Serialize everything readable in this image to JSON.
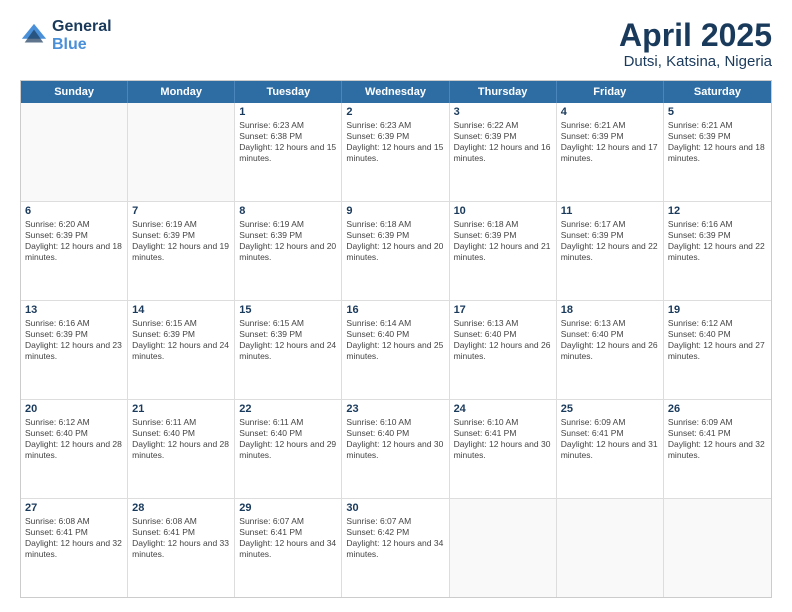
{
  "logo": {
    "line1": "General",
    "line2": "Blue"
  },
  "title": "April 2025",
  "subtitle": "Dutsi, Katsina, Nigeria",
  "days": [
    "Sunday",
    "Monday",
    "Tuesday",
    "Wednesday",
    "Thursday",
    "Friday",
    "Saturday"
  ],
  "weeks": [
    [
      {
        "day": "",
        "sunrise": "",
        "sunset": "",
        "daylight": ""
      },
      {
        "day": "",
        "sunrise": "",
        "sunset": "",
        "daylight": ""
      },
      {
        "day": "1",
        "sunrise": "Sunrise: 6:23 AM",
        "sunset": "Sunset: 6:38 PM",
        "daylight": "Daylight: 12 hours and 15 minutes."
      },
      {
        "day": "2",
        "sunrise": "Sunrise: 6:23 AM",
        "sunset": "Sunset: 6:39 PM",
        "daylight": "Daylight: 12 hours and 15 minutes."
      },
      {
        "day": "3",
        "sunrise": "Sunrise: 6:22 AM",
        "sunset": "Sunset: 6:39 PM",
        "daylight": "Daylight: 12 hours and 16 minutes."
      },
      {
        "day": "4",
        "sunrise": "Sunrise: 6:21 AM",
        "sunset": "Sunset: 6:39 PM",
        "daylight": "Daylight: 12 hours and 17 minutes."
      },
      {
        "day": "5",
        "sunrise": "Sunrise: 6:21 AM",
        "sunset": "Sunset: 6:39 PM",
        "daylight": "Daylight: 12 hours and 18 minutes."
      }
    ],
    [
      {
        "day": "6",
        "sunrise": "Sunrise: 6:20 AM",
        "sunset": "Sunset: 6:39 PM",
        "daylight": "Daylight: 12 hours and 18 minutes."
      },
      {
        "day": "7",
        "sunrise": "Sunrise: 6:19 AM",
        "sunset": "Sunset: 6:39 PM",
        "daylight": "Daylight: 12 hours and 19 minutes."
      },
      {
        "day": "8",
        "sunrise": "Sunrise: 6:19 AM",
        "sunset": "Sunset: 6:39 PM",
        "daylight": "Daylight: 12 hours and 20 minutes."
      },
      {
        "day": "9",
        "sunrise": "Sunrise: 6:18 AM",
        "sunset": "Sunset: 6:39 PM",
        "daylight": "Daylight: 12 hours and 20 minutes."
      },
      {
        "day": "10",
        "sunrise": "Sunrise: 6:18 AM",
        "sunset": "Sunset: 6:39 PM",
        "daylight": "Daylight: 12 hours and 21 minutes."
      },
      {
        "day": "11",
        "sunrise": "Sunrise: 6:17 AM",
        "sunset": "Sunset: 6:39 PM",
        "daylight": "Daylight: 12 hours and 22 minutes."
      },
      {
        "day": "12",
        "sunrise": "Sunrise: 6:16 AM",
        "sunset": "Sunset: 6:39 PM",
        "daylight": "Daylight: 12 hours and 22 minutes."
      }
    ],
    [
      {
        "day": "13",
        "sunrise": "Sunrise: 6:16 AM",
        "sunset": "Sunset: 6:39 PM",
        "daylight": "Daylight: 12 hours and 23 minutes."
      },
      {
        "day": "14",
        "sunrise": "Sunrise: 6:15 AM",
        "sunset": "Sunset: 6:39 PM",
        "daylight": "Daylight: 12 hours and 24 minutes."
      },
      {
        "day": "15",
        "sunrise": "Sunrise: 6:15 AM",
        "sunset": "Sunset: 6:39 PM",
        "daylight": "Daylight: 12 hours and 24 minutes."
      },
      {
        "day": "16",
        "sunrise": "Sunrise: 6:14 AM",
        "sunset": "Sunset: 6:40 PM",
        "daylight": "Daylight: 12 hours and 25 minutes."
      },
      {
        "day": "17",
        "sunrise": "Sunrise: 6:13 AM",
        "sunset": "Sunset: 6:40 PM",
        "daylight": "Daylight: 12 hours and 26 minutes."
      },
      {
        "day": "18",
        "sunrise": "Sunrise: 6:13 AM",
        "sunset": "Sunset: 6:40 PM",
        "daylight": "Daylight: 12 hours and 26 minutes."
      },
      {
        "day": "19",
        "sunrise": "Sunrise: 6:12 AM",
        "sunset": "Sunset: 6:40 PM",
        "daylight": "Daylight: 12 hours and 27 minutes."
      }
    ],
    [
      {
        "day": "20",
        "sunrise": "Sunrise: 6:12 AM",
        "sunset": "Sunset: 6:40 PM",
        "daylight": "Daylight: 12 hours and 28 minutes."
      },
      {
        "day": "21",
        "sunrise": "Sunrise: 6:11 AM",
        "sunset": "Sunset: 6:40 PM",
        "daylight": "Daylight: 12 hours and 28 minutes."
      },
      {
        "day": "22",
        "sunrise": "Sunrise: 6:11 AM",
        "sunset": "Sunset: 6:40 PM",
        "daylight": "Daylight: 12 hours and 29 minutes."
      },
      {
        "day": "23",
        "sunrise": "Sunrise: 6:10 AM",
        "sunset": "Sunset: 6:40 PM",
        "daylight": "Daylight: 12 hours and 30 minutes."
      },
      {
        "day": "24",
        "sunrise": "Sunrise: 6:10 AM",
        "sunset": "Sunset: 6:41 PM",
        "daylight": "Daylight: 12 hours and 30 minutes."
      },
      {
        "day": "25",
        "sunrise": "Sunrise: 6:09 AM",
        "sunset": "Sunset: 6:41 PM",
        "daylight": "Daylight: 12 hours and 31 minutes."
      },
      {
        "day": "26",
        "sunrise": "Sunrise: 6:09 AM",
        "sunset": "Sunset: 6:41 PM",
        "daylight": "Daylight: 12 hours and 32 minutes."
      }
    ],
    [
      {
        "day": "27",
        "sunrise": "Sunrise: 6:08 AM",
        "sunset": "Sunset: 6:41 PM",
        "daylight": "Daylight: 12 hours and 32 minutes."
      },
      {
        "day": "28",
        "sunrise": "Sunrise: 6:08 AM",
        "sunset": "Sunset: 6:41 PM",
        "daylight": "Daylight: 12 hours and 33 minutes."
      },
      {
        "day": "29",
        "sunrise": "Sunrise: 6:07 AM",
        "sunset": "Sunset: 6:41 PM",
        "daylight": "Daylight: 12 hours and 34 minutes."
      },
      {
        "day": "30",
        "sunrise": "Sunrise: 6:07 AM",
        "sunset": "Sunset: 6:42 PM",
        "daylight": "Daylight: 12 hours and 34 minutes."
      },
      {
        "day": "",
        "sunrise": "",
        "sunset": "",
        "daylight": ""
      },
      {
        "day": "",
        "sunrise": "",
        "sunset": "",
        "daylight": ""
      },
      {
        "day": "",
        "sunrise": "",
        "sunset": "",
        "daylight": ""
      }
    ]
  ]
}
